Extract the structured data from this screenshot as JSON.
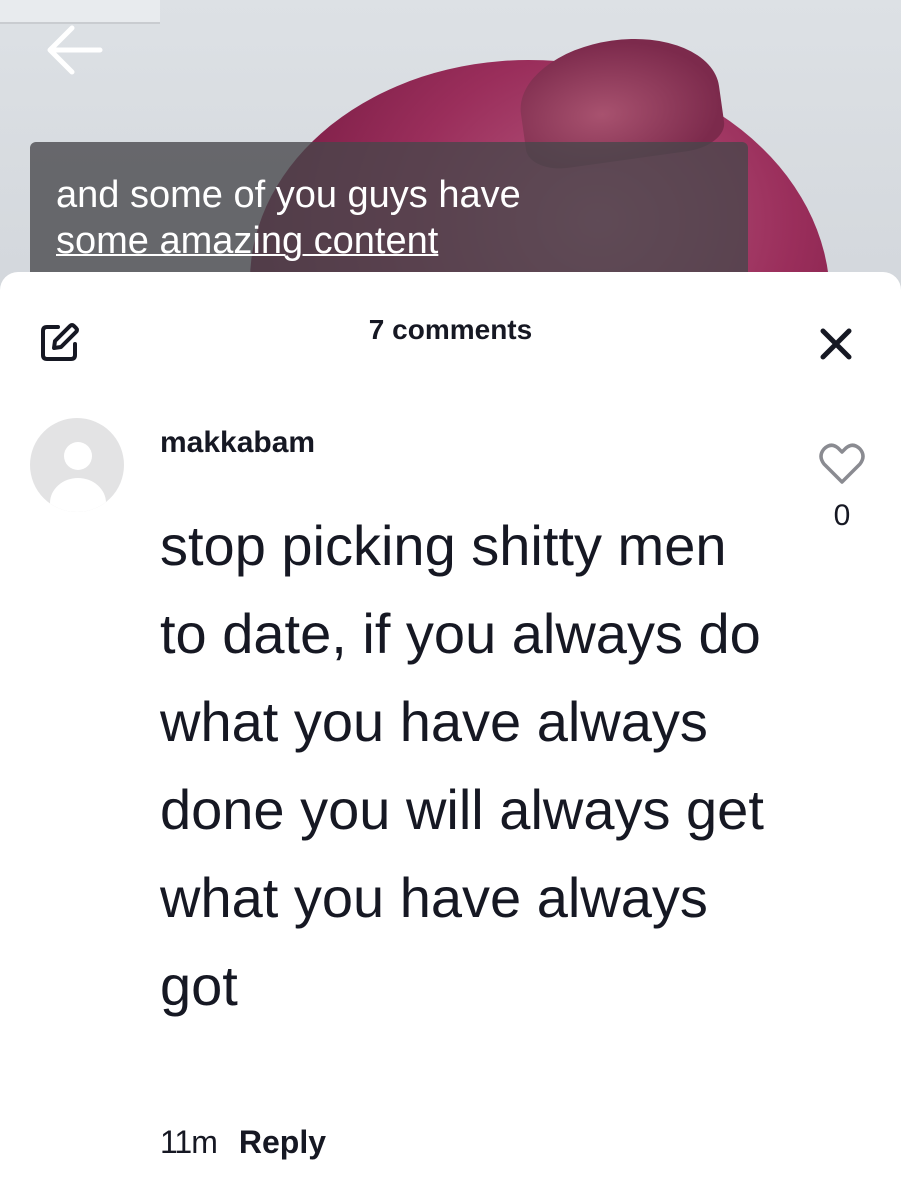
{
  "video": {
    "caption_line1": "and some of you guys have",
    "caption_line2": "some amazing content"
  },
  "icons": {
    "back": "back-arrow-icon",
    "edit": "edit-icon",
    "close": "close-icon",
    "like": "heart-icon"
  },
  "comments_sheet": {
    "title": "7 comments",
    "comments": [
      {
        "username": "makkabam",
        "text": "stop picking shitty men to date, if you always do what you have always done you will always get what you have always got",
        "time": "11m",
        "reply_label": "Reply",
        "like_count": "0"
      }
    ]
  },
  "colors": {
    "text": "#161823",
    "sheet_bg": "#ffffff",
    "caption_bg": "#46464a",
    "hair": "#9a2e5b"
  }
}
